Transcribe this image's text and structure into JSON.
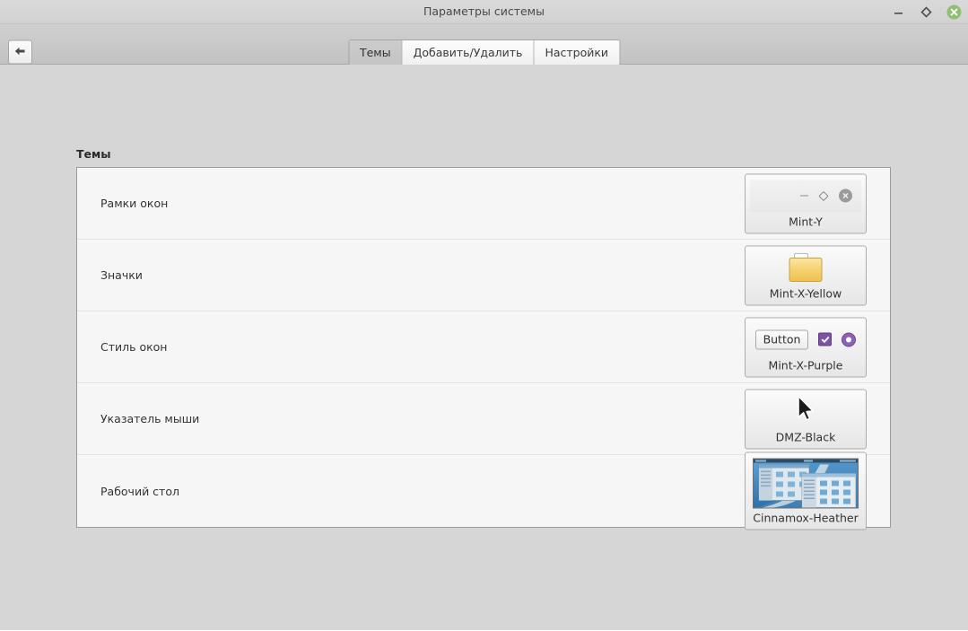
{
  "window": {
    "title": "Параметры системы",
    "controls": [
      {
        "name": "minimize",
        "label": "Свернуть"
      },
      {
        "name": "maximize",
        "label": "Развернуть"
      },
      {
        "name": "close",
        "label": "Закрыть",
        "color": "#8fbf73"
      }
    ]
  },
  "toolbar": {
    "back_label": "Назад",
    "tabs": [
      {
        "label": "Темы",
        "selected": true
      },
      {
        "label": "Добавить/Удалить",
        "selected": false
      },
      {
        "label": "Настройки",
        "selected": false
      }
    ]
  },
  "main": {
    "section_title": "Темы",
    "rows": [
      {
        "label": "Рамки окон",
        "theme": "Mint-Y",
        "preview": "window-frame"
      },
      {
        "label": "Значки",
        "theme": "Mint-X-Yellow",
        "preview": "folder-icon"
      },
      {
        "label": "Стиль окон",
        "theme": "Mint-X-Purple",
        "preview": "widget-style",
        "button_label": "Button"
      },
      {
        "label": "Указатель мыши",
        "theme": "DMZ-Black",
        "preview": "mouse-cursor"
      },
      {
        "label": "Рабочий стол",
        "theme": "Cinnamox-Heather",
        "preview": "desktop-thumbnail"
      }
    ]
  },
  "colors": {
    "accent_purple": "#7d53a8",
    "folder_yellow": "#f5d06a",
    "close_green": "#8fbf73",
    "panel_bg": "#f6f6f6",
    "page_bg": "#d6d6d6"
  }
}
